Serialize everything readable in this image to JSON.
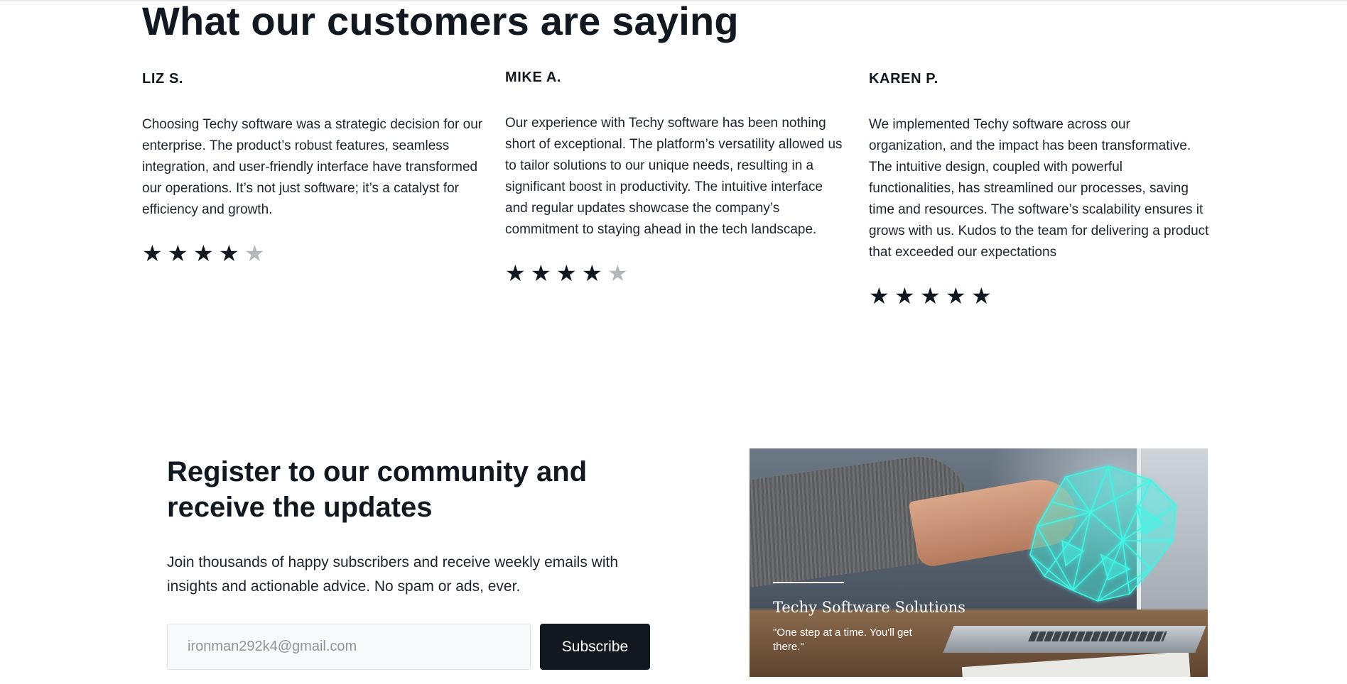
{
  "testimonials": {
    "title": "What our customers are saying",
    "reviews": [
      {
        "name": "LIZ S.",
        "text": "Choosing Techy software was a strategic decision for our enterprise. The product’s robust features, seamless integration, and user-friendly interface have transformed our operations. It’s not just software; it’s a catalyst for efficiency and growth.",
        "rating": 4,
        "max_rating": 5
      },
      {
        "name": "MIKE A.",
        "text": "Our experience with Techy software has been nothing short of exceptional. The platform’s versatility allowed us to tailor solutions to our unique needs, resulting in a significant boost in productivity. The intuitive interface and regular updates showcase the company’s commitment to staying ahead in the tech landscape.",
        "rating": 4,
        "max_rating": 5
      },
      {
        "name": "KAREN P.",
        "text": "We implemented Techy software across our organization, and the impact has been transformative. The intuitive design, coupled with powerful functionalities, has streamlined our processes, saving time and resources. The software’s scalability ensures it grows with us. Kudos to the team for delivering a product that exceeded our expectations",
        "rating": 5,
        "max_rating": 5
      }
    ]
  },
  "register": {
    "title": "Register to our community and receive the updates",
    "description": "Join thousands of happy subscribers and receive weekly emails with insights and actionable advice. No spam or ads, ever.",
    "email_placeholder": "ironman292k4@gmail.com",
    "subscribe_label": "Subscribe"
  },
  "promo_image": {
    "brand": "Techy Software Solutions",
    "tagline": "\"One step at a time. You'll get there.\""
  },
  "colors": {
    "text": "#111820",
    "star_on": "#111820",
    "star_off": "#b3b7bc",
    "button_bg": "#111820",
    "hand_glow": "#3ff5e6"
  },
  "icons": {
    "star_filled": "star-icon",
    "star_empty": "star-empty-icon"
  }
}
